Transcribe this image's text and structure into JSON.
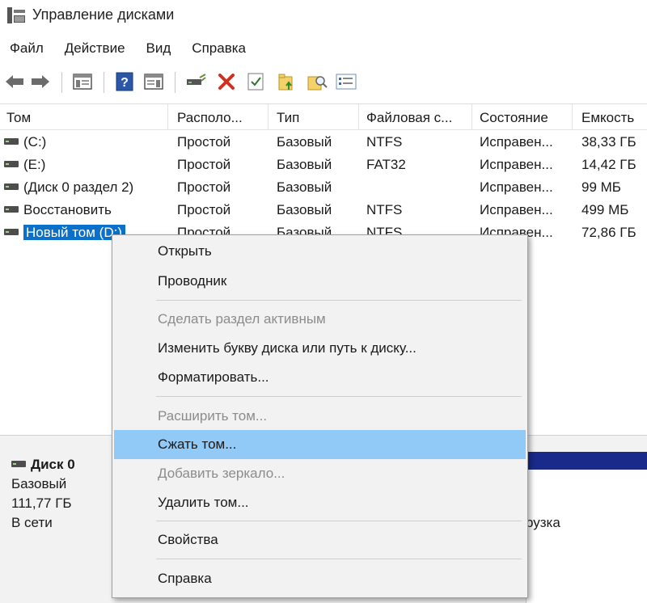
{
  "window": {
    "title": "Управление дисками"
  },
  "menu": [
    "Файл",
    "Действие",
    "Вид",
    "Справка"
  ],
  "toolbar_icons": [
    "back-arrow-icon",
    "forward-arrow-icon",
    "console-tree-icon",
    "help-icon",
    "action-pane-icon",
    "connect-disk-icon",
    "delete-icon",
    "properties-checklist-icon",
    "folder-up-icon",
    "find-icon",
    "settings-list-icon"
  ],
  "table": {
    "columns": [
      "Том",
      "Располо...",
      "Тип",
      "Файловая с...",
      "Состояние",
      "Емкость"
    ],
    "rows": [
      {
        "name": "(C:)",
        "layout": "Простой",
        "type": "Базовый",
        "fs": "NTFS",
        "status": "Исправен...",
        "capacity": "38,33 ГБ"
      },
      {
        "name": "(E:)",
        "layout": "Простой",
        "type": "Базовый",
        "fs": "FAT32",
        "status": "Исправен...",
        "capacity": "14,42 ГБ"
      },
      {
        "name": "(Диск 0 раздел 2)",
        "layout": "Простой",
        "type": "Базовый",
        "fs": "",
        "status": "Исправен...",
        "capacity": "99 МБ"
      },
      {
        "name": "Восстановить",
        "layout": "Простой",
        "type": "Базовый",
        "fs": "NTFS",
        "status": "Исправен...",
        "capacity": "499 МБ"
      },
      {
        "name": "Новый том (D:)",
        "layout": "Простой",
        "type": "Базовый",
        "fs": "NTFS",
        "status": "Исправен...",
        "capacity": "72,86 ГБ"
      }
    ]
  },
  "disk": {
    "name": "Диск 0",
    "type": "Базовый",
    "size": "111,77 ГБ",
    "state": "В сети",
    "partition_text": "рузка"
  },
  "context_menu": [
    {
      "label": "Открыть",
      "enabled": true
    },
    {
      "label": "Проводник",
      "enabled": true
    },
    {
      "label": "Сделать раздел активным",
      "enabled": false
    },
    {
      "label": "Изменить букву диска или путь к диску...",
      "enabled": true
    },
    {
      "label": "Форматировать...",
      "enabled": true
    },
    {
      "label": "Расширить том...",
      "enabled": false
    },
    {
      "label": "Сжать том...",
      "enabled": true,
      "highlighted": true
    },
    {
      "label": "Добавить зеркало...",
      "enabled": false
    },
    {
      "label": "Удалить том...",
      "enabled": true
    },
    {
      "label": "Свойства",
      "enabled": true
    },
    {
      "label": "Справка",
      "enabled": true
    }
  ]
}
